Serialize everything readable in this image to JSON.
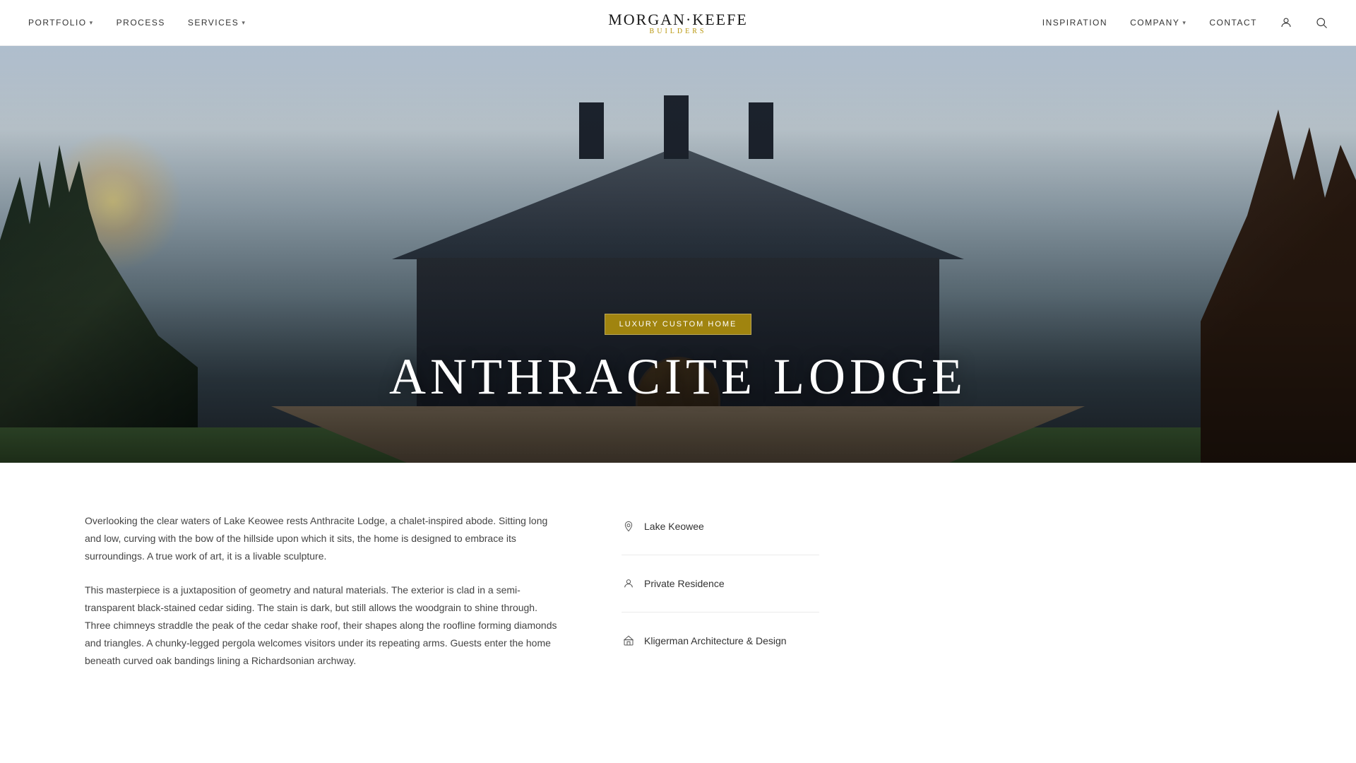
{
  "nav": {
    "logo_main": "MORGAN·KEEFE",
    "logo_sub": "BUILDERS",
    "items_left": [
      {
        "id": "portfolio",
        "label": "PORTFOLIO",
        "has_dropdown": true
      },
      {
        "id": "process",
        "label": "PROCESS",
        "has_dropdown": false
      },
      {
        "id": "services",
        "label": "SERVICES",
        "has_dropdown": true
      }
    ],
    "items_right": [
      {
        "id": "inspiration",
        "label": "INSPIRATION",
        "has_dropdown": false
      },
      {
        "id": "company",
        "label": "COMPANY",
        "has_dropdown": true
      },
      {
        "id": "contact",
        "label": "CONTACT",
        "has_dropdown": false
      }
    ]
  },
  "hero": {
    "tag": "LUXURY CUSTOM HOME",
    "title": "ANTHRACITE LODGE"
  },
  "content": {
    "paragraphs": [
      "Overlooking the clear waters of Lake Keowee rests Anthracite Lodge, a chalet-inspired abode. Sitting long and low, curving with the bow of the hillside upon which it sits, the home is designed to embrace its surroundings. A true work of art, it is a livable sculpture.",
      "This masterpiece is a juxtaposition of geometry and natural materials. The exterior is clad in a semi-transparent black-stained cedar siding. The stain is dark, but still allows the woodgrain to shine through. Three chimneys straddle the peak of the cedar shake roof, their shapes along the roofline forming diamonds and triangles. A chunky-legged pergola welcomes visitors under its repeating arms. Guests enter the home beneath curved oak bandings lining a Richardsonian archway."
    ]
  },
  "details": [
    {
      "id": "location",
      "icon": "📍",
      "text": "Lake Keowee"
    },
    {
      "id": "type",
      "icon": "👤",
      "text": "Private Residence"
    },
    {
      "id": "architect",
      "icon": "🏛",
      "text": "Kligerman Architecture & Design"
    }
  ]
}
